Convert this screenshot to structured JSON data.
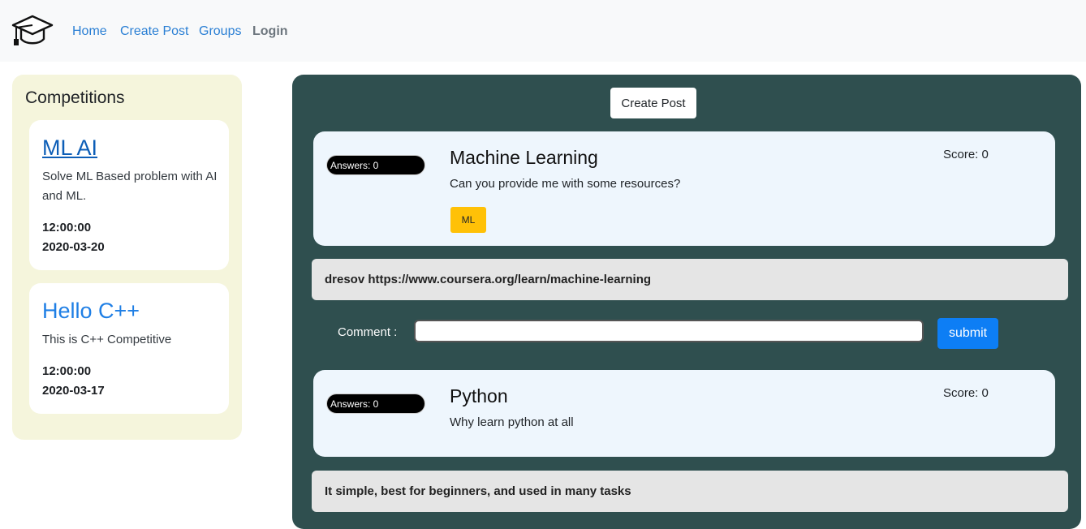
{
  "navbar": {
    "logo_icon": "graduation-cap-icon",
    "links": [
      {
        "label": "Home"
      },
      {
        "label": "Create Post"
      },
      {
        "label": "Groups"
      },
      {
        "label": "Login"
      }
    ]
  },
  "sidebar": {
    "title": "Competitions",
    "competitions": [
      {
        "title": "ML AI",
        "description": "Solve ML Based problem with AI and ML.",
        "time": "12:00:00",
        "date": "2020-03-20"
      },
      {
        "title": "Hello C++",
        "description": "This is C++ Competitive",
        "time": "12:00:00",
        "date": "2020-03-17"
      }
    ]
  },
  "feed": {
    "create_post_label": "Create Post",
    "comment_label": "Comment :",
    "comment_value": "",
    "submit_label": "submit",
    "posts": [
      {
        "answers": "Answers: 0",
        "title": "Machine Learning",
        "body": "Can you provide me with some resources?",
        "score": "Score: 0",
        "tag": "ML",
        "comment": "dresov https://www.coursera.org/learn/machine-learning"
      },
      {
        "answers": "Answers: 0",
        "title": "Python",
        "body": "Why learn python at all",
        "score": "Score: 0",
        "comment": "It simple, best for beginners, and used in many tasks"
      }
    ]
  },
  "colors": {
    "navbar_bg": "#f8f9fa",
    "link": "#2a7fd4",
    "sidebar_bg": "#f5f5dc",
    "feed_bg": "#2f4f4f",
    "post_bg": "#eef6fd",
    "tag_bg": "#ffc107",
    "submit_bg": "#0d7ef5"
  }
}
